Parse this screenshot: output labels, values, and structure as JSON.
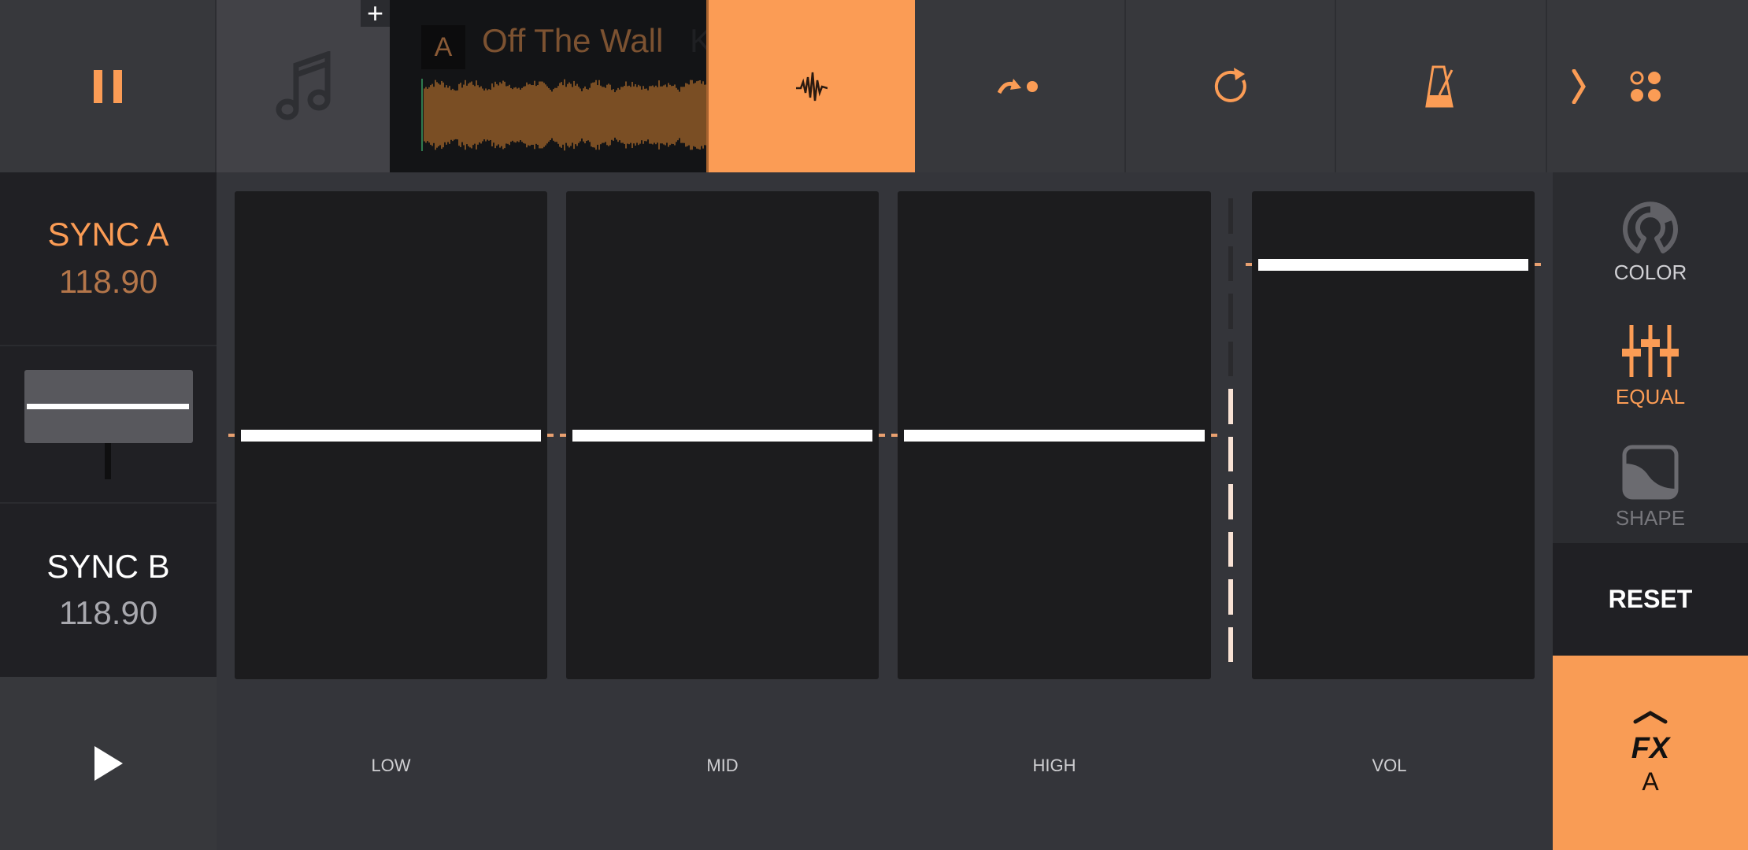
{
  "topbar": {
    "pause_icon": "pause-icon",
    "library_icon": "music-note-icon",
    "add_label": "+",
    "track": {
      "deck": "A",
      "title": "Off The Wall",
      "title_overflow": "K"
    },
    "buttons": [
      {
        "name": "waveform",
        "icon": "waveform-icon",
        "active": true
      },
      {
        "name": "cue",
        "icon": "cue-jump-icon",
        "active": false
      },
      {
        "name": "loop",
        "icon": "loop-icon",
        "active": false
      },
      {
        "name": "metronome",
        "icon": "metronome-icon",
        "active": false
      },
      {
        "name": "more",
        "icon": "chevron-right-icon",
        "active": false
      },
      {
        "name": "pads",
        "icon": "pads-icon",
        "active": false
      }
    ]
  },
  "left": {
    "sync_a": {
      "label": "SYNC A",
      "bpm": "118.90"
    },
    "sync_b": {
      "label": "SYNC B",
      "bpm": "118.90"
    },
    "crossfader_position": 0.5,
    "play_icon": "play-icon"
  },
  "eq": {
    "channels": [
      {
        "label": "LOW",
        "value": 0.5
      },
      {
        "label": "MID",
        "value": 0.5
      },
      {
        "label": "HIGH",
        "value": 0.5
      },
      {
        "label": "VOL",
        "value": 0.85
      }
    ],
    "vu_level": 0.55,
    "vu_segments": 10
  },
  "right": {
    "modes": [
      {
        "label": "COLOR",
        "icon": "color-knob-icon",
        "active": false
      },
      {
        "label": "EQUAL",
        "icon": "equalizer-icon",
        "active": true
      },
      {
        "label": "SHAPE",
        "icon": "shape-curve-icon",
        "active": false
      }
    ],
    "reset_label": "RESET",
    "fx": {
      "label": "FX",
      "deck": "A",
      "icon": "chevron-up-icon"
    }
  },
  "colors": {
    "accent": "#fb9c55",
    "accent_dim": "#7c5231",
    "bg": "#34353a",
    "panel": "#1c1c1e"
  }
}
